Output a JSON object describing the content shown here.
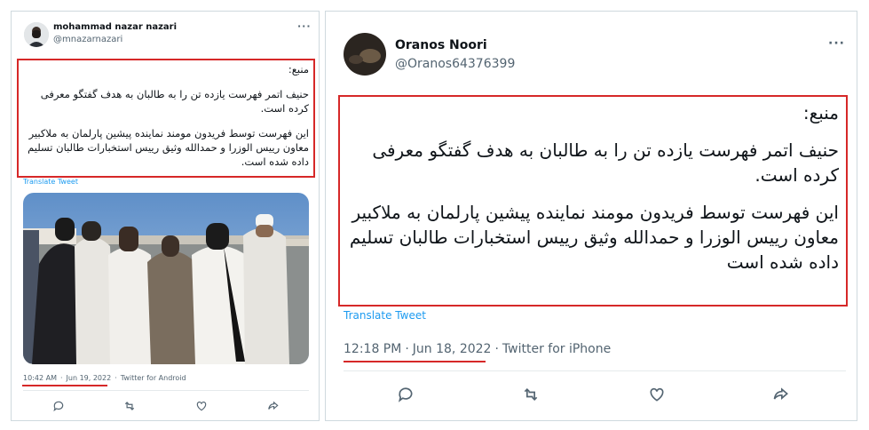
{
  "left_tweet": {
    "display_name": "mohammad nazar nazari",
    "handle": "@mnazarnazari",
    "more": "···",
    "text": {
      "source_label": "منبع:",
      "paragraph1": "حنیف اتمر فهرست یازده تن را به طالبان به هدف گفتگو معرفی کرده است.",
      "paragraph2": "این فهرست توسط فریدون مومند نماینده پیشین پارلمان به ملاکبیر معاون رییس الوزرا و حمدالله وثیق رییس استخبارات طالبان تسلیم داده شده است."
    },
    "translate": "Translate Tweet",
    "time": "10:42 AM",
    "date": "Jun 19, 2022",
    "client": "Twitter for Android"
  },
  "right_tweet": {
    "display_name": "Oranos Noori",
    "handle": "@Oranos64376399",
    "more": "···",
    "text": {
      "source_label": "منبع:",
      "paragraph1": "حنیف اتمر فهرست یازده تن را به طالبان به هدف گفتگو معرفی کرده است.",
      "paragraph2": "این فهرست توسط فریدون مومند نماینده پیشین پارلمان به ملاکبیر معاون رییس الوزرا و حمدالله وثیق رییس استخبارات طالبان تسلیم داده شده است"
    },
    "translate": "Translate Tweet",
    "time": "12:18 PM",
    "date": "Jun 18, 2022",
    "client": "Twitter for iPhone"
  },
  "icons": [
    "reply-icon",
    "retweet-icon",
    "like-icon",
    "share-icon"
  ],
  "colors": {
    "highlight": "#d62828",
    "link": "#1d9bf0",
    "muted": "#536471"
  }
}
